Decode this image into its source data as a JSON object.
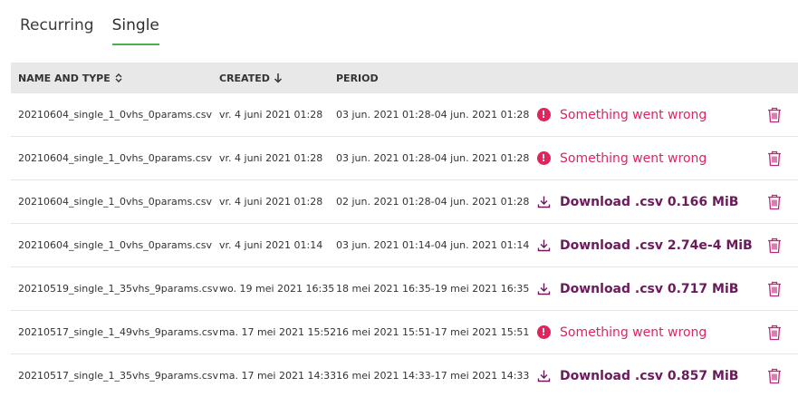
{
  "tabs": [
    {
      "label": "Recurring",
      "active": false
    },
    {
      "label": "Single",
      "active": true
    }
  ],
  "table": {
    "headers": {
      "name": "NAME AND TYPE",
      "created": "CREATED",
      "period": "PERIOD"
    },
    "rows": [
      {
        "name": "20210604_single_1_0vhs_0params.csv",
        "created": "vr. 4 juni 2021 01:28",
        "period": "03 jun. 2021 01:28-04 jun. 2021 01:28",
        "status": "error",
        "status_text": "Something went wrong"
      },
      {
        "name": "20210604_single_1_0vhs_0params.csv",
        "created": "vr. 4 juni 2021 01:28",
        "period": "03 jun. 2021 01:28-04 jun. 2021 01:28",
        "status": "error",
        "status_text": "Something went wrong"
      },
      {
        "name": "20210604_single_1_0vhs_0params.csv",
        "created": "vr. 4 juni 2021 01:28",
        "period": "02 jun. 2021 01:28-04 jun. 2021 01:28",
        "status": "download",
        "status_text": "Download .csv 0.166 MiB"
      },
      {
        "name": "20210604_single_1_0vhs_0params.csv",
        "created": "vr. 4 juni 2021 01:14",
        "period": "03 jun. 2021 01:14-04 jun. 2021 01:14",
        "status": "download",
        "status_text": "Download .csv 2.74e-4 MiB"
      },
      {
        "name": "20210519_single_1_35vhs_9params.csv",
        "created": "wo. 19 mei 2021 16:35",
        "period": "18 mei 2021 16:35-19 mei 2021 16:35",
        "status": "download",
        "status_text": "Download .csv 0.717 MiB"
      },
      {
        "name": "20210517_single_1_49vhs_9params.csv",
        "created": "ma. 17 mei 2021 15:52",
        "period": "16 mei 2021 15:51-17 mei 2021 15:51",
        "status": "error",
        "status_text": "Something went wrong"
      },
      {
        "name": "20210517_single_1_35vhs_9params.csv",
        "created": "ma. 17 mei 2021 14:33",
        "period": "16 mei 2021 14:33-17 mei 2021 14:33",
        "status": "download",
        "status_text": "Download .csv 0.857 MiB"
      }
    ]
  },
  "colors": {
    "accent_tab": "#4caf50",
    "error": "#e0245e",
    "download": "#6b1a5c",
    "trash": "#c0287a"
  },
  "icons": {
    "sort": "sort-updown-icon",
    "sort_desc": "arrow-down-icon",
    "error": "error-circle-icon",
    "download": "download-icon",
    "delete": "trash-icon"
  }
}
